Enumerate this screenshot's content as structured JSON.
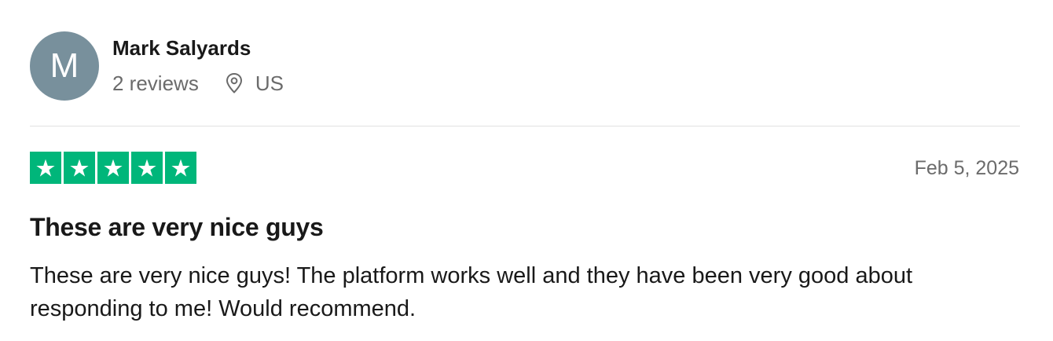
{
  "reviewer": {
    "initial": "M",
    "name": "Mark Salyards",
    "review_count": "2 reviews",
    "country": "US",
    "avatar_color": "#78909c",
    "location_icon": "map-pin-icon"
  },
  "review": {
    "rating": 5,
    "rating_max": 5,
    "star_color": "#00b67a",
    "date": "Feb 5, 2025",
    "title": "These are very nice guys",
    "body": "These are very nice guys! The platform works well and they have been very good about responding to me! Would recommend."
  }
}
